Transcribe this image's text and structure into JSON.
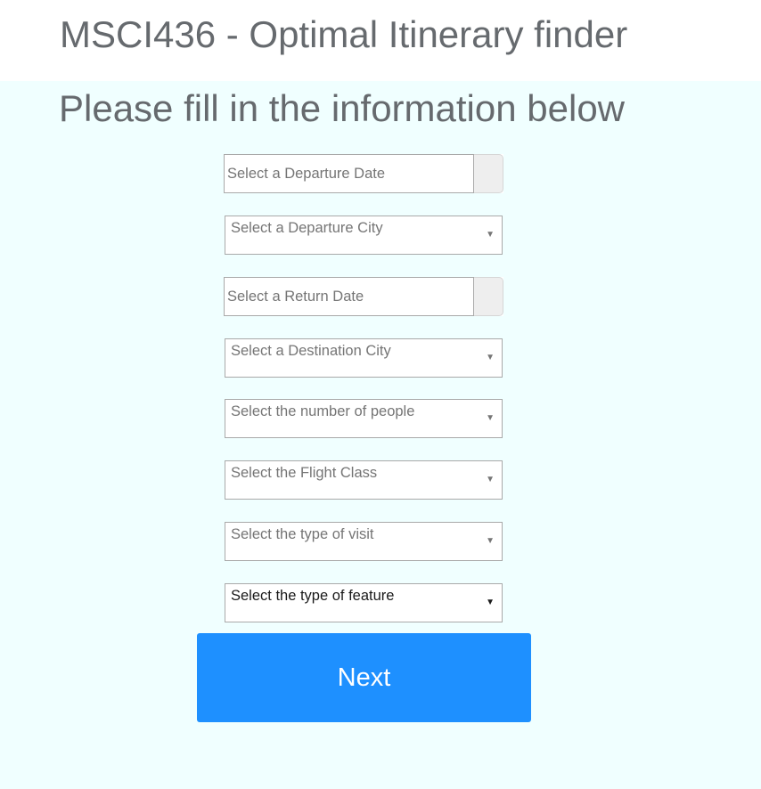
{
  "header": {
    "title": "MSCI436 - Optimal Itinerary finder"
  },
  "main": {
    "subtitle": "Please fill in the information below",
    "departure_date": {
      "placeholder": "Select a Departure Date"
    },
    "departure_city": {
      "placeholder": "Select a Departure City"
    },
    "return_date": {
      "placeholder": "Select a Return Date"
    },
    "destination_city": {
      "placeholder": "Select a Destination City"
    },
    "number_of_people": {
      "placeholder": "Select the number of people"
    },
    "flight_class": {
      "placeholder": "Select the Flight Class"
    },
    "type_of_visit": {
      "placeholder": "Select the type of visit"
    },
    "type_of_feature": {
      "placeholder": "Select the type of feature"
    },
    "caret_glyph": "▼",
    "next_button": "Next"
  },
  "colors": {
    "header_background": "#ffffff",
    "content_background": "#f0ffff",
    "heading_text": "#666a6e",
    "button_background": "#1e90ff",
    "button_text": "#ffffff"
  }
}
